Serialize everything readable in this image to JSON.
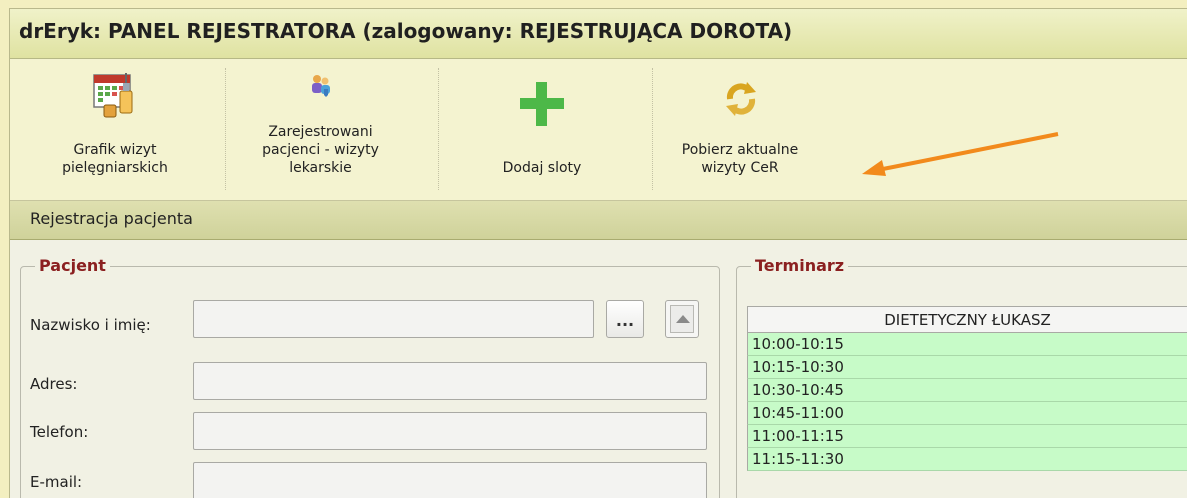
{
  "window": {
    "title": "drEryk: PANEL REJESTRATORA (zalogowany: REJESTRUJĄCA DOROTA)"
  },
  "toolbar": {
    "buttons": [
      {
        "label_line1": "Grafik wizyt",
        "label_line2": "pielęgniarskich",
        "icon": "calendar-syringe-icon"
      },
      {
        "label_line1": "Zarejestrowani",
        "label_line2": "pacjenci - wizyty",
        "label_line3": "lekarskie",
        "icon": "registered-patients-icon"
      },
      {
        "label_line1": "Dodaj sloty",
        "icon": "plus-icon"
      },
      {
        "label_line1": "Pobierz aktualne",
        "label_line2": "wizyty CeR",
        "icon": "refresh-icon"
      }
    ]
  },
  "section": {
    "title": "Rejestracja pacjenta"
  },
  "patient": {
    "legend": "Pacjent",
    "name_label": "Nazwisko i imię:",
    "name_value": "",
    "browse_label": "...",
    "address_label": "Adres:",
    "address_value": "",
    "phone_label": "Telefon:",
    "phone_value": "",
    "email_label": "E-mail:",
    "email_value": ""
  },
  "schedule": {
    "legend": "Terminarz",
    "column_header": "DIETETYCZNY ŁUKASZ",
    "slots": [
      "10:00-10:15",
      "10:15-10:30",
      "10:30-10:45",
      "10:45-11:00",
      "11:00-11:15",
      "11:15-11:30"
    ]
  },
  "colors": {
    "accent_legend": "#8b2020",
    "slot_free": "#c7fbc8",
    "plus_green": "#4db848",
    "annotation_arrow": "#f28a1c"
  }
}
